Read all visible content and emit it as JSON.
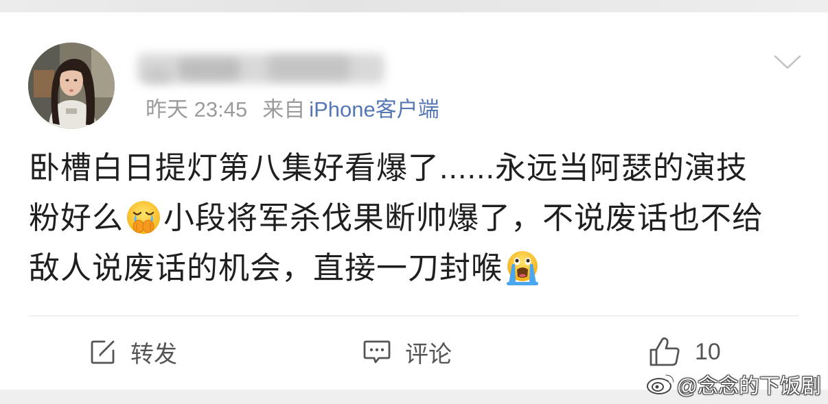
{
  "post": {
    "meta": {
      "time": "昨天 23:45",
      "source_prefix": "来自",
      "source": "iPhone客户端"
    },
    "text": {
      "line1": "卧槽白日提灯第八集好看爆了......永远当阿瑟的演技",
      "line2_a": "粉好么",
      "line2_b": "小段将军杀伐果断帅爆了，不说废话也不给",
      "line3": "敌人说废话的机会，直接一刀封喉"
    },
    "emojis": [
      "crying-covering-mouth-emoji",
      "loudly-crying-emoji"
    ]
  },
  "actions": {
    "repost_label": "转发",
    "comment_label": "评论",
    "like_count": "10"
  },
  "icons": {
    "menu": "chevron-down-icon",
    "repost": "repost-icon",
    "comment": "comment-icon",
    "like": "thumbs-up-icon",
    "watermark_logo": "weibo-logo-icon"
  },
  "watermark": {
    "text": "@念念的下饭剧"
  },
  "colors": {
    "text": "#1f1f1f",
    "meta": "#9b9b9b",
    "source_link": "#5577b3",
    "action": "#555555",
    "divider": "#e6e6e6"
  }
}
